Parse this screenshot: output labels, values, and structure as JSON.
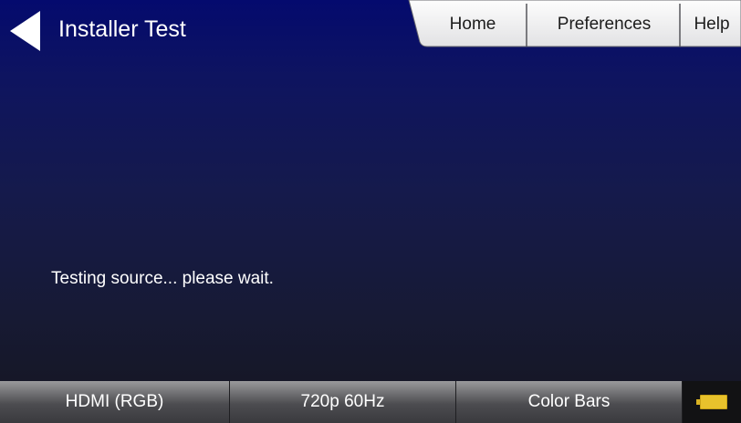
{
  "header": {
    "title": "Installer Test",
    "back_icon": "back-arrow-icon",
    "tabs": [
      {
        "label": "Home"
      },
      {
        "label": "Preferences"
      },
      {
        "label": "Help"
      }
    ]
  },
  "main": {
    "status_message": "Testing source... please wait."
  },
  "footer": {
    "interface": "HDMI (RGB)",
    "format": "720p 60Hz",
    "pattern": "Color Bars",
    "battery_icon": "battery-icon"
  },
  "colors": {
    "background_top": "#040a6e",
    "background_bottom": "#15151f",
    "tab_face": "#f2f2f2",
    "battery": "#e8c22c"
  }
}
